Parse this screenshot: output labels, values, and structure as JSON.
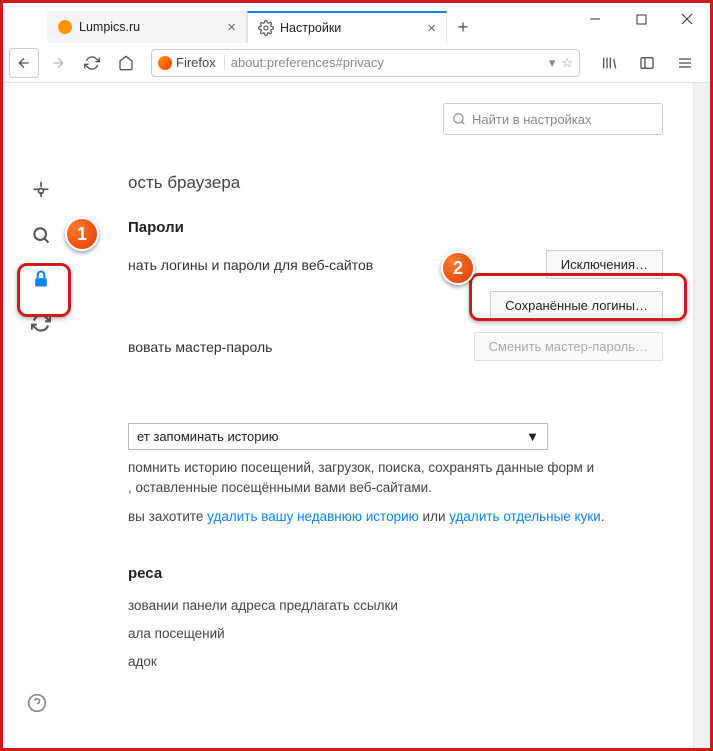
{
  "window": {
    "tab1": "Lumpics.ru",
    "tab2": "Настройки"
  },
  "url": {
    "brand": "Firefox",
    "addr": "about:preferences#privacy"
  },
  "search": {
    "placeholder": "Найти в настройках"
  },
  "heading": "ость браузера",
  "passwords": {
    "title": "Пароли",
    "save": "нать логины и пароли для веб-сайтов",
    "exceptions": "Исключения…",
    "saved": "Сохранённые логины…",
    "master": "вовать мастер-пароль",
    "change": "Сменить мастер-пароль…"
  },
  "history": {
    "dropdown": "ет запоминать историю",
    "para1": "помнить историю посещений, загрузок, поиска, сохранять данные форм и",
    "para1b": ", оставленные посещёнными вами веб-сайтами.",
    "para2a": "вы захотите ",
    "link1": "удалить вашу недавнюю историю",
    "para2b": " или ",
    "link2": "удалить отдельные куки",
    "para2c": "."
  },
  "addr": {
    "title": "реса",
    "l1": "зовании панели адреса предлагать ссылки",
    "l2": "ала посещений",
    "l3": "адок"
  },
  "badge1": "1",
  "badge2": "2"
}
